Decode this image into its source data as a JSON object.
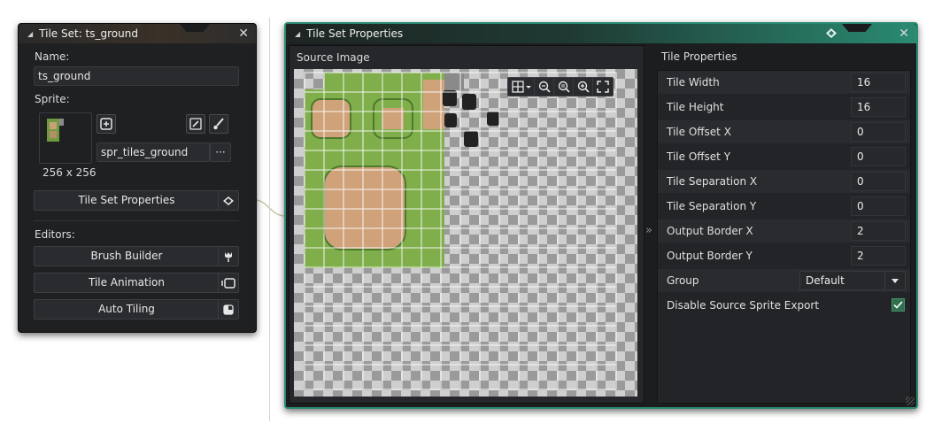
{
  "tileset_panel": {
    "title": "Tile Set: ts_ground",
    "name_label": "Name:",
    "name_value": "ts_ground",
    "sprite_label": "Sprite:",
    "sprite_name": "spr_tiles_ground",
    "sprite_more": "···",
    "sprite_size": "256 x 256",
    "properties_button": "Tile Set Properties",
    "editors_label": "Editors:",
    "editors": [
      {
        "label": "Brush Builder",
        "icon": "tulip-icon"
      },
      {
        "label": "Tile Animation",
        "icon": "film-icon"
      },
      {
        "label": "Auto Tiling",
        "icon": "autotile-icon"
      }
    ]
  },
  "properties_window": {
    "title": "Tile Set Properties",
    "source_image_label": "Source Image",
    "tile_properties_label": "Tile Properties",
    "collapse_glyph": "»",
    "rows": [
      {
        "label": "Tile Width",
        "value": "16"
      },
      {
        "label": "Tile Height",
        "value": "16"
      },
      {
        "label": "Tile Offset X",
        "value": "0"
      },
      {
        "label": "Tile Offset Y",
        "value": "0"
      },
      {
        "label": "Tile Separation X",
        "value": "0"
      },
      {
        "label": "Tile Separation Y",
        "value": "0"
      },
      {
        "label": "Output Border X",
        "value": "2"
      },
      {
        "label": "Output Border Y",
        "value": "2"
      }
    ],
    "group_label": "Group",
    "group_value": "Default",
    "disable_export_label": "Disable Source Sprite Export",
    "disable_export_checked": true
  },
  "colors": {
    "accent": "#2a8a72",
    "panel_bg": "#1f2022",
    "grass": "#7fae4a",
    "dirt": "#cfa27a",
    "grid": "#ffffff"
  }
}
